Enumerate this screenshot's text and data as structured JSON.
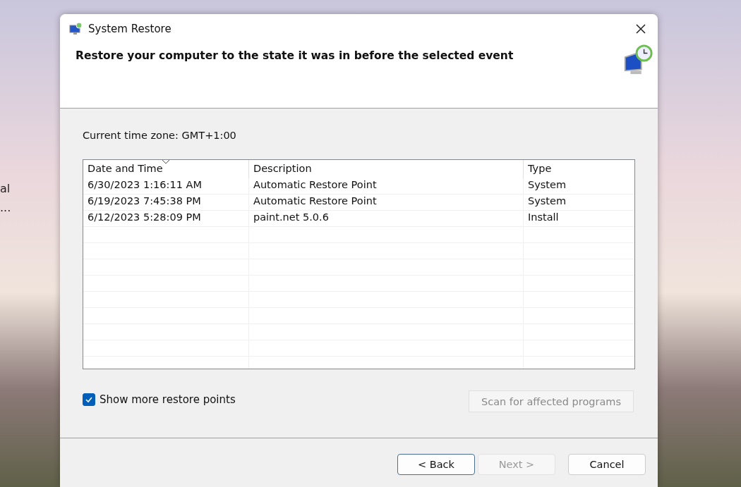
{
  "desktop": {
    "icon_labels": [
      "al",
      "..."
    ]
  },
  "window": {
    "title": "System Restore",
    "heading": "Restore your computer to the state it was in before the selected event"
  },
  "timezone": "Current time zone: GMT+1:00",
  "table": {
    "columns": [
      {
        "label": "Date and Time",
        "sorted": true
      },
      {
        "label": "Description",
        "sorted": false
      },
      {
        "label": "Type",
        "sorted": false
      }
    ],
    "rows": [
      {
        "cells": [
          "6/30/2023 1:16:11 AM",
          "Automatic Restore Point",
          "System"
        ],
        "selected": false
      },
      {
        "cells": [
          "6/19/2023 7:45:38 PM",
          "Automatic Restore Point",
          "System"
        ],
        "selected": false
      },
      {
        "cells": [
          "6/12/2023 5:28:09 PM",
          "paint.net 5.0.6",
          "Install"
        ],
        "selected": false
      }
    ]
  },
  "show_more": {
    "label": "Show more restore points",
    "checked": true
  },
  "scan_button": {
    "label": "Scan for affected programs",
    "disabled": true
  },
  "buttons": [
    {
      "label": "< Back",
      "disabled": false,
      "kind": "focused"
    },
    {
      "label": "Next >",
      "disabled": true,
      "kind": "normal"
    },
    {
      "label": "Cancel",
      "disabled": false,
      "kind": "normal"
    }
  ]
}
